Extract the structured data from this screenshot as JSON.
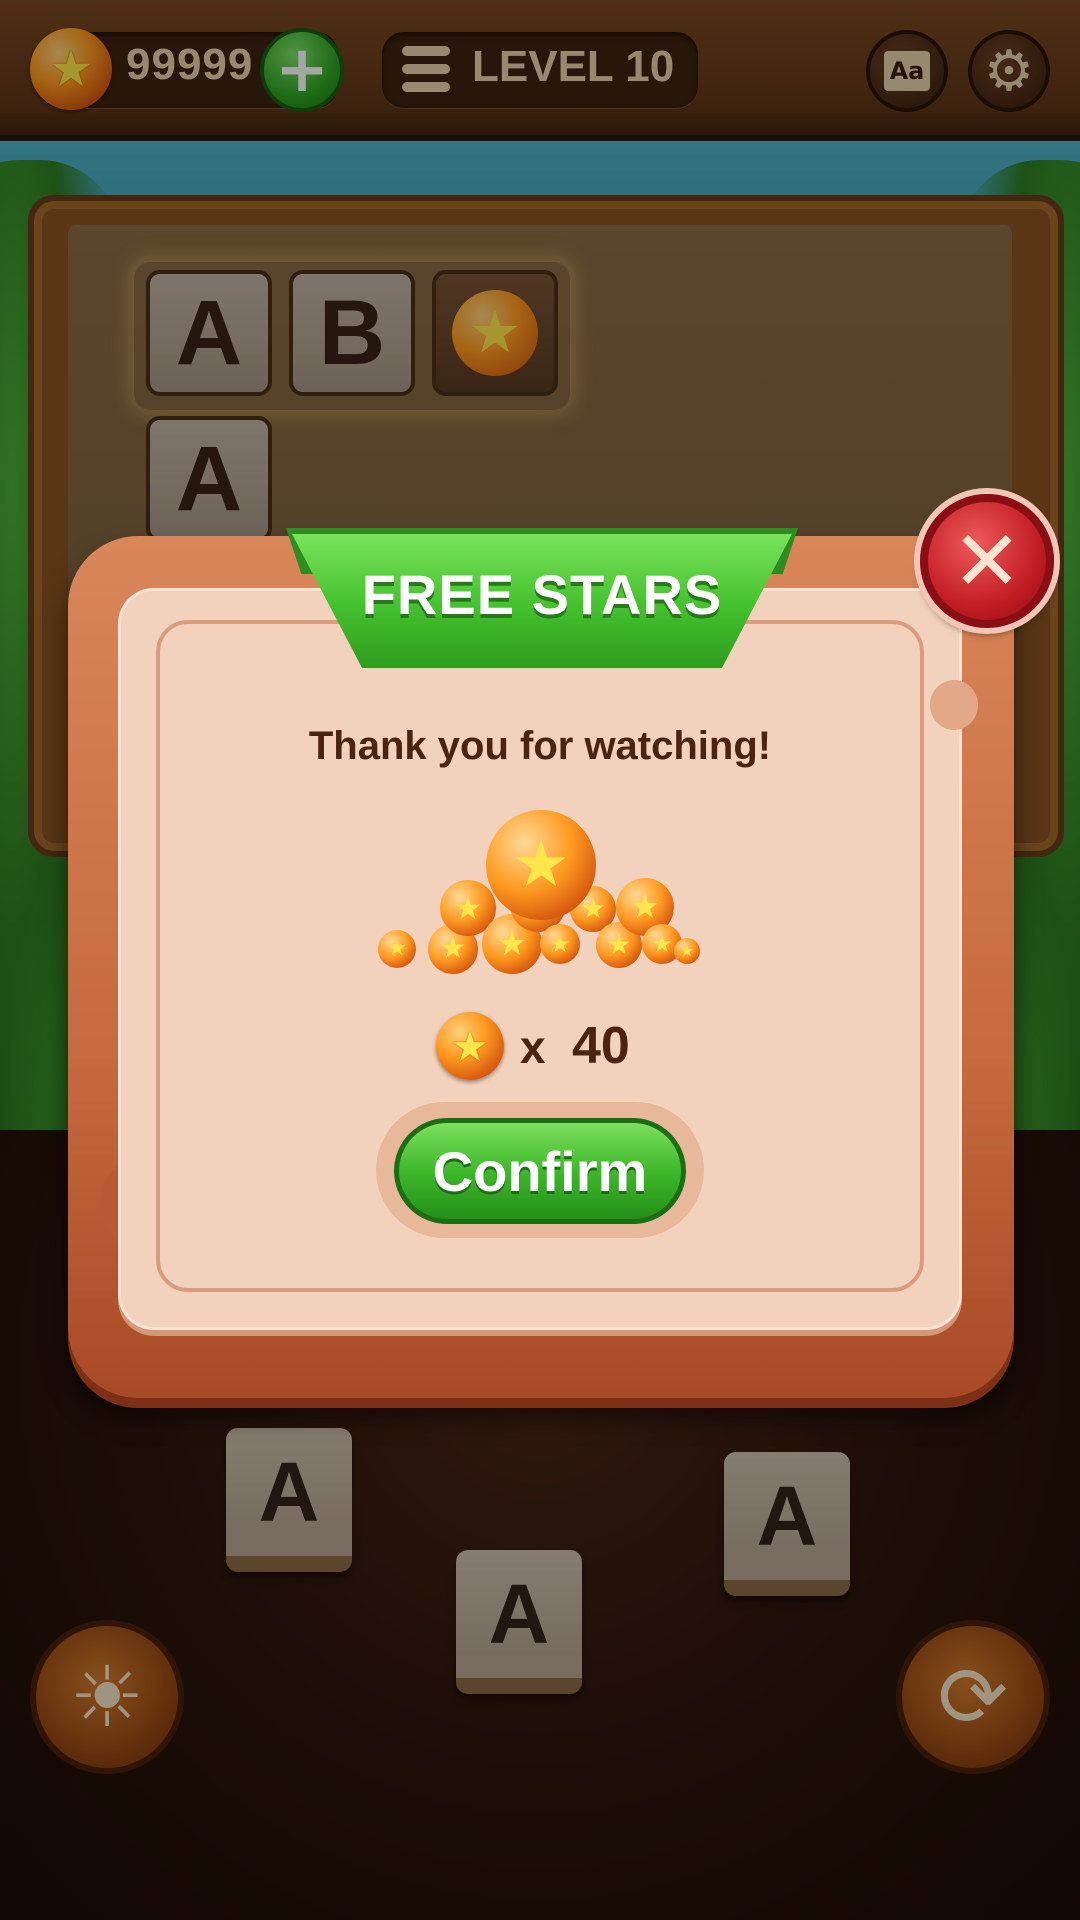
{
  "topbar": {
    "coins": "99999",
    "level": "LEVEL 10",
    "dictionary_icon_text": "Aa"
  },
  "board": {
    "answer_tiles": [
      "A",
      "B"
    ],
    "answer_tiles_row2": [
      "A"
    ]
  },
  "letter_pool": [
    "A",
    "A",
    "A"
  ],
  "dialog": {
    "title": "FREE STARS",
    "message": "Thank you for watching!",
    "reward_multiplier": "x",
    "reward_amount": "40",
    "confirm_label": "Confirm"
  },
  "colors": {
    "banner_green": "#43c02d",
    "confirm_green": "#3fb82a",
    "close_red": "#c21e24",
    "dialog_body": "#f2d2bd",
    "dialog_frame": "#c66a3f",
    "text_brown": "#4b2312"
  },
  "icons": {
    "coin": "star-coin-icon",
    "plus": "plus-icon",
    "level_list": "list-icon",
    "dictionary": "dictionary-icon",
    "settings": "gear-icon",
    "close": "close-icon",
    "hint": "lightbulb-icon",
    "shuffle": "refresh-icon"
  }
}
